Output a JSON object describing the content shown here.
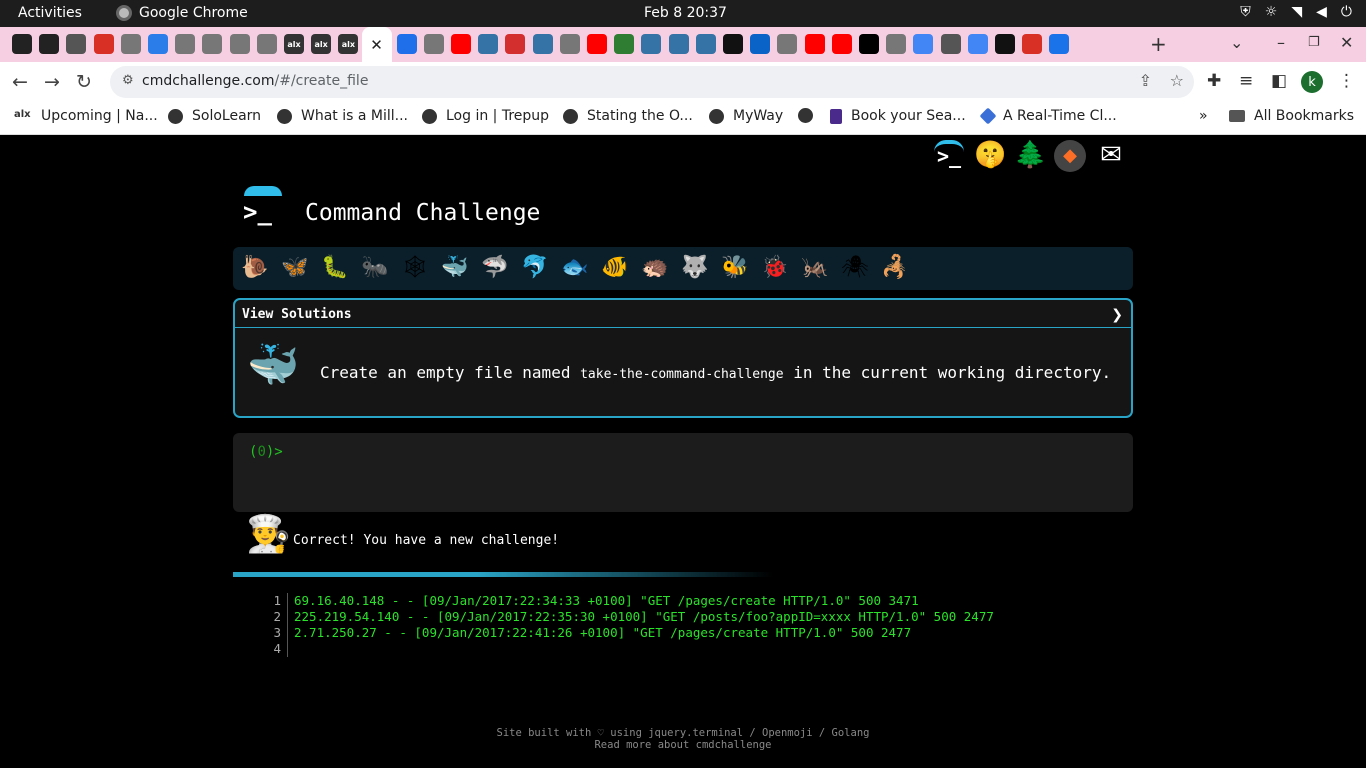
{
  "system": {
    "activities": "Activities",
    "app_name": "Google Chrome",
    "clock": "Feb 8  20:37",
    "tray": [
      "shield-icon",
      "brightness-icon",
      "wifi-icon",
      "volume-icon",
      "power-icon"
    ]
  },
  "tabs": {
    "icons": [
      "github",
      "github",
      "audio",
      "gmail",
      "generic",
      "globe",
      "generic",
      "generic",
      "generic",
      "generic",
      "alx",
      "alx",
      "alx",
      "close",
      "edge",
      "generic",
      "youtube",
      "python",
      "pdf",
      "python",
      "generic",
      "youtube",
      "link",
      "python",
      "python",
      "python",
      "openai",
      "outlook",
      "generic",
      "youtube",
      "youtube",
      "wix",
      "generic",
      "google",
      "chrome",
      "google",
      "flash",
      "gmail",
      "contacts"
    ],
    "active_close": "✕",
    "new_tab": "+",
    "window_controls": [
      "⌄",
      "–",
      "❐",
      "✕"
    ]
  },
  "toolbar": {
    "url_host": "cmdchallenge.com",
    "url_path": "/#/create_file",
    "profile_initial": "k"
  },
  "bookmarks": {
    "items": [
      {
        "label": "Upcoming | Na...",
        "icon": "alx-icon"
      },
      {
        "label": "SoloLearn",
        "icon": "globe-icon"
      },
      {
        "label": "What is a Mill...",
        "icon": "globe-icon"
      },
      {
        "label": "Log in | Trepup",
        "icon": "globe-icon"
      },
      {
        "label": "Stating the O...",
        "icon": "globe-icon"
      },
      {
        "label": "MyWay",
        "icon": "globe-icon"
      },
      {
        "label": "Book your Sea...",
        "icon": "ticket-icon"
      },
      {
        "label": "A Real-Time Cl...",
        "icon": "diamond-icon"
      }
    ],
    "overflow": "»",
    "all_bookmarks": "All Bookmarks"
  },
  "page": {
    "title": "Command Challenge",
    "corner_icons": [
      "terminal-icon",
      "shush-face-icon",
      "tree-icon",
      "gitlab-icon",
      "envelope-icon"
    ],
    "creatures": [
      "🐌",
      "🦋",
      "🐛",
      "🐜",
      "🕸",
      "🐳",
      "🦈",
      "🐬",
      "🐟",
      "🐠",
      "🦔",
      "🐺",
      "🐝",
      "🐞",
      "🦗",
      "🕷",
      "🦂"
    ],
    "solutions_header": "View Solutions",
    "solutions_chevron": "❯",
    "task_prefix": "Create an empty file named ",
    "task_file": "take-the-command-challenge",
    "task_suffix": " in the current working directory.",
    "prompt_open": "(",
    "prompt_zero": "0",
    "prompt_close": ")>",
    "status_message": "Correct! You have a new challenge!",
    "progress_fraction": 0.4,
    "file_lines": [
      {
        "no": "1",
        "text": "69.16.40.148 - - [09/Jan/2017:22:34:33 +0100] \"GET /pages/create HTTP/1.0\" 500 3471"
      },
      {
        "no": "2",
        "text": "225.219.54.140 - - [09/Jan/2017:22:35:30 +0100] \"GET /posts/foo?appID=xxxx HTTP/1.0\" 500 2477"
      },
      {
        "no": "3",
        "text": "2.71.250.27 - - [09/Jan/2017:22:41:26 +0100] \"GET /pages/create HTTP/1.0\" 500 2477"
      },
      {
        "no": "4",
        "text": ""
      }
    ],
    "footer_line1": "Site built with ♡ using jquery.terminal / Openmoji / Golang",
    "footer_line2": "Read more about cmdchallenge"
  },
  "colors": {
    "accent": "#2aa4c6",
    "terminal_green": "#2be22b",
    "tab_bar": "#f7cfe2"
  }
}
